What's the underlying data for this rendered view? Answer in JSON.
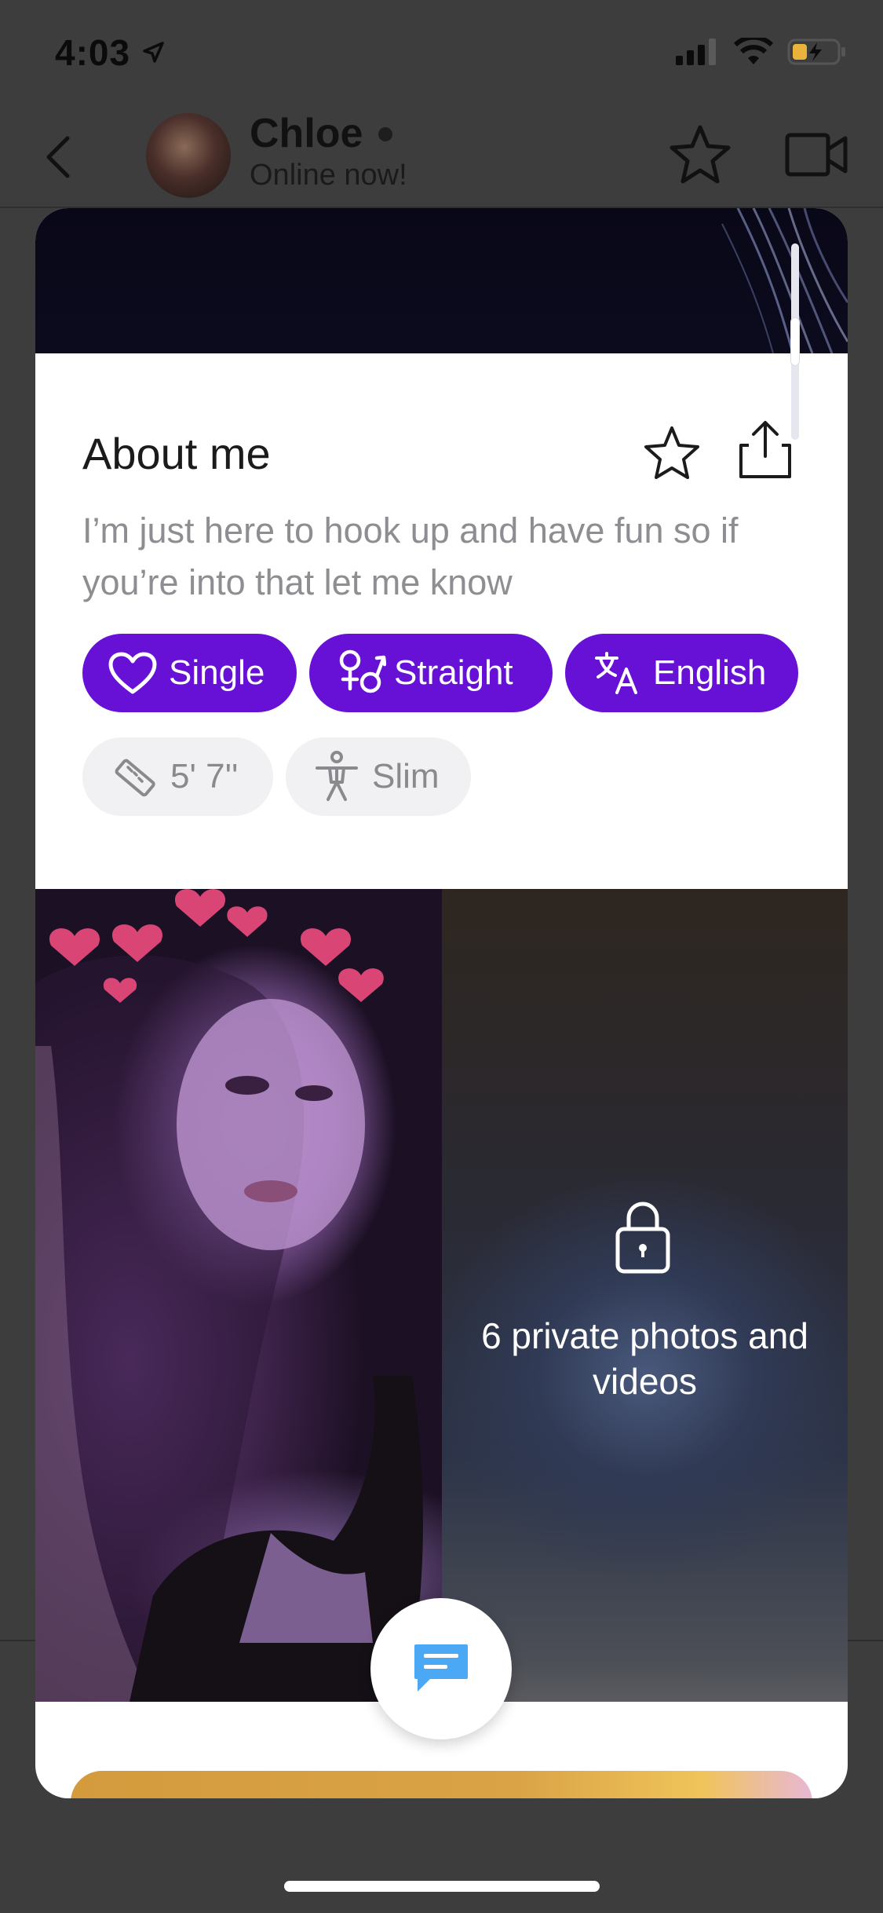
{
  "status_bar": {
    "time": "4:03"
  },
  "chat_header": {
    "name": "Chloe",
    "status": "Online now!"
  },
  "about": {
    "title": "About me",
    "bio": "I’m just here to hook up and have fun so if you’re into that let me know"
  },
  "tags": {
    "relationship": "Single",
    "orientation": "Straight",
    "language": "English",
    "height": "5' 7''",
    "body_type": "Slim"
  },
  "photos": {
    "private_label": "6 private photos and videos"
  },
  "colors": {
    "accent_purple": "#6711d6",
    "chip_gray_bg": "#f1f1f3",
    "chat_button_blue": "#4aa8f5"
  },
  "icons": {
    "back": "chevron-left-icon",
    "favorite": "star-icon",
    "video_call": "video-camera-icon",
    "share": "share-icon",
    "heart": "heart-icon",
    "gender": "gender-icon",
    "translate": "translate-icon",
    "ruler": "ruler-icon",
    "body": "person-icon",
    "lock": "lock-icon",
    "chat": "chat-bubble-icon"
  }
}
